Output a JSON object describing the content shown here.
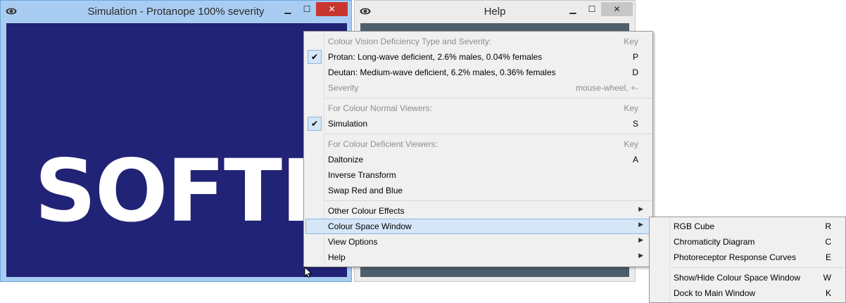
{
  "sim_window": {
    "title": "Simulation - Protanope 100% severity",
    "min_glyph": "▁",
    "max_glyph": "☐",
    "close_glyph": "✕",
    "logo_text": "SOFTP"
  },
  "help_window": {
    "title": "Help",
    "min_glyph": "▁",
    "max_glyph": "☐",
    "close_glyph": "✕"
  },
  "menu": {
    "cvd_header": {
      "label": "Colour Vision Deficiency Type and Severity:",
      "key": "Key"
    },
    "protan": {
      "label": "Protan: Long-wave deficient, 2.6% males, 0.04% females",
      "key": "P",
      "checked": true
    },
    "deutan": {
      "label": "Deutan: Medium-wave deficient, 6.2% males, 0.36% females",
      "key": "D"
    },
    "severity": {
      "label": "Severity",
      "key": "mouse-wheel, +-"
    },
    "normal_header": {
      "label": "For Colour Normal Viewers:",
      "key": "Key"
    },
    "simulation": {
      "label": "Simulation",
      "key": "S",
      "checked": true
    },
    "deficient_header": {
      "label": "For Colour Deficient Viewers:",
      "key": "Key"
    },
    "daltonize": {
      "label": "Daltonize",
      "key": "A"
    },
    "inverse": {
      "label": "Inverse Transform"
    },
    "swap": {
      "label": "Swap Red and Blue"
    },
    "other_effects": {
      "label": "Other Colour Effects"
    },
    "colour_space_window": {
      "label": "Colour Space Window"
    },
    "view_options": {
      "label": "View Options"
    },
    "help": {
      "label": "Help"
    },
    "arrow_glyph": "▶",
    "check_glyph": "✔"
  },
  "submenu": {
    "rgb_cube": {
      "label": "RGB Cube",
      "key": "R"
    },
    "chromaticity": {
      "label": "Chromaticity Diagram",
      "key": "C"
    },
    "photoreceptor": {
      "label": "Photoreceptor Response Curves",
      "key": "E"
    },
    "show_hide": {
      "label": "Show/Hide Colour Space Window",
      "key": "W"
    },
    "dock": {
      "label": "Dock to Main Window",
      "key": "K"
    }
  },
  "icons": {
    "window_icon": "eye-icon",
    "check": "check-icon",
    "submenu_arrow": "chevron-right-icon",
    "cursor": "mouse-pointer-icon"
  },
  "colors": {
    "sim_background": "#212376",
    "active_frame": "#a9cdf2",
    "close_red": "#c8372f",
    "menu_highlight": "#d5e6f7"
  }
}
